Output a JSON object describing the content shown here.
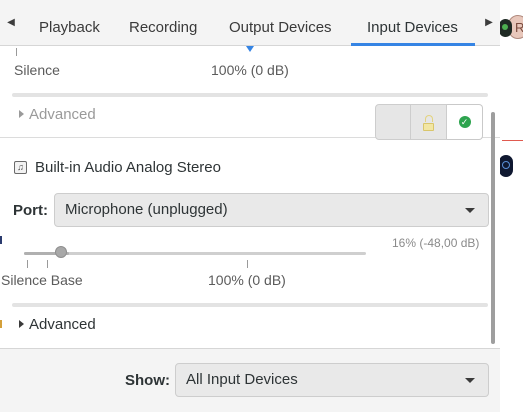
{
  "tabs": [
    {
      "label": "Playback",
      "active": false
    },
    {
      "label": "Recording",
      "active": false
    },
    {
      "label": "Output Devices",
      "active": false
    },
    {
      "label": "Input Devices",
      "active": true
    }
  ],
  "accent_color": "#3584e4",
  "prev_device": {
    "silence_label": "Silence",
    "volume_mark": "100% (0 dB)",
    "advanced_label": "Advanced"
  },
  "device": {
    "name": "Built-in Audio Analog Stereo",
    "icon": "audio-card-icon",
    "lock_icon": "lock-icon",
    "default_icon": "checkmark-icon",
    "port_label": "Port:",
    "port_value": "Microphone (unplugged)",
    "volume_readout": "16% (-48,00 dB)",
    "volume_fraction": 0.16,
    "silence_base_label": "Silence Base",
    "volume_mark": "100% (0 dB)",
    "advanced_label": "Advanced"
  },
  "bottom": {
    "show_label": "Show:",
    "show_value": "All Input Devices"
  },
  "background_app": {
    "avatar_letter": "R"
  }
}
